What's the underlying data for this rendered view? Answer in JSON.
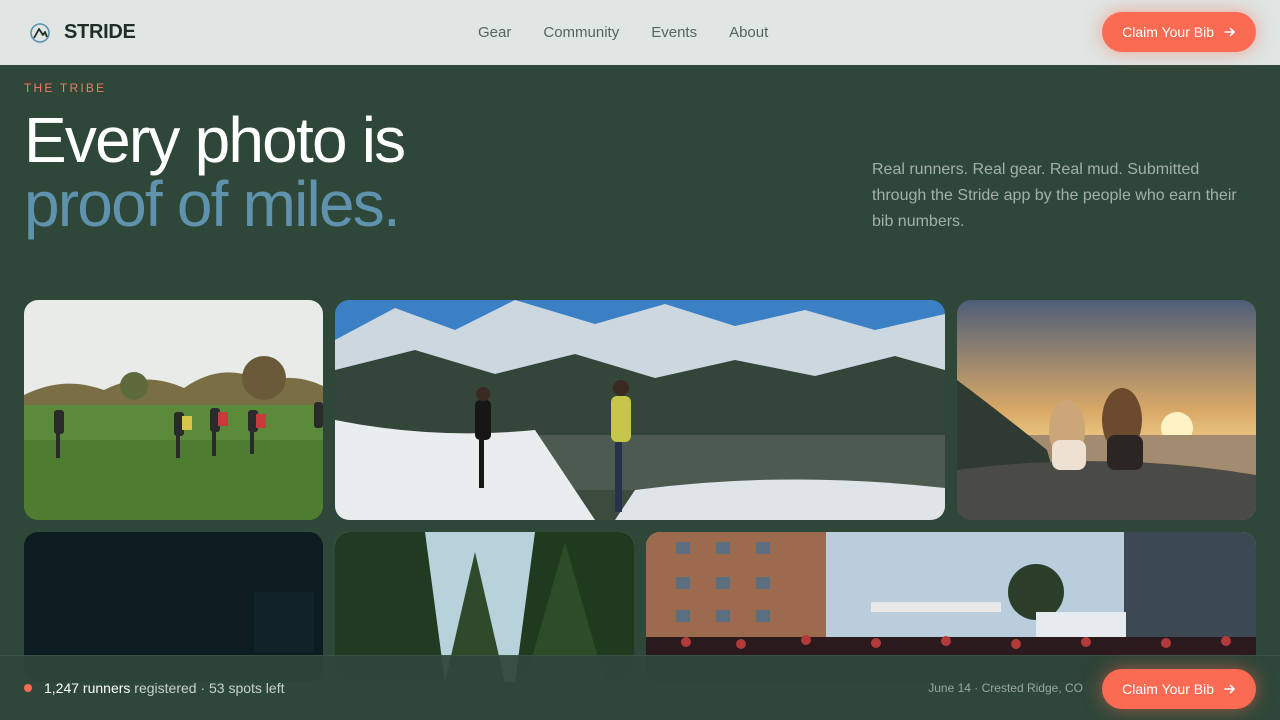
{
  "brand": {
    "name": "STRIDE"
  },
  "nav": {
    "items": [
      "Gear",
      "Community",
      "Events",
      "About"
    ]
  },
  "cta": {
    "label": "Claim Your Bib"
  },
  "hero": {
    "eyebrow": "THE TRIBE",
    "headline_line1": "Every photo is",
    "headline_line2": "proof of miles.",
    "copy": "Real runners. Real gear. Real mud. Submitted through the Stride app by the people who earn their bib numbers."
  },
  "footer": {
    "runners_count": "1,247 runners",
    "registered_word": " registered · 53 spots left",
    "event_info": "June 14 · Crested Ridge, CO"
  },
  "colors": {
    "accent": "#fb6b53",
    "background": "#2f4739",
    "headline_highlight": "#5f93ad",
    "topbar": "#dfe6e3"
  }
}
